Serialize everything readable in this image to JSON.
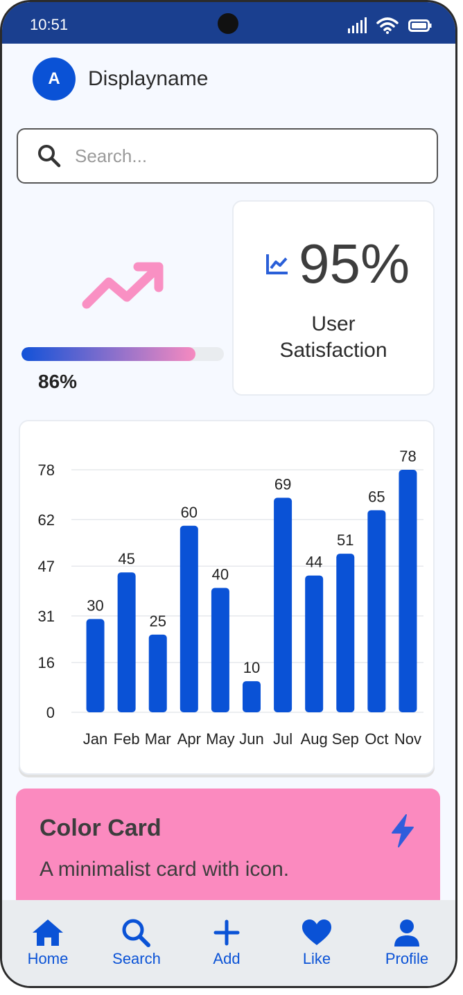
{
  "status_bar": {
    "time": "10:51"
  },
  "profile": {
    "avatar_letter": "A",
    "display_name": "Displayname"
  },
  "search": {
    "placeholder": "Search...",
    "value": ""
  },
  "progress": {
    "value": 86,
    "label": "86%"
  },
  "stat_card": {
    "value": "95%",
    "label": "User Satisfaction"
  },
  "chart_data": {
    "type": "bar",
    "categories": [
      "Jan",
      "Feb",
      "Mar",
      "Apr",
      "May",
      "Jun",
      "Jul",
      "Aug",
      "Sep",
      "Oct",
      "Nov"
    ],
    "values": [
      30,
      45,
      25,
      60,
      40,
      10,
      69,
      44,
      51,
      65,
      78
    ],
    "yticks": [
      0,
      16,
      31,
      47,
      62,
      78
    ],
    "ylim": [
      0,
      78
    ],
    "grid": true,
    "data_labels": true,
    "color": "#0a52d6"
  },
  "color_card": {
    "title": "Color Card",
    "description": "A minimalist card with icon."
  },
  "bottom_nav": [
    {
      "label": "Home",
      "icon": "home-icon"
    },
    {
      "label": "Search",
      "icon": "search-icon"
    },
    {
      "label": "Add",
      "icon": "plus-icon"
    },
    {
      "label": "Like",
      "icon": "heart-icon"
    },
    {
      "label": "Profile",
      "icon": "person-icon"
    }
  ],
  "colors": {
    "accent": "#0a52d6",
    "header": "#1a3f8f",
    "pink": "#fb8abf"
  }
}
